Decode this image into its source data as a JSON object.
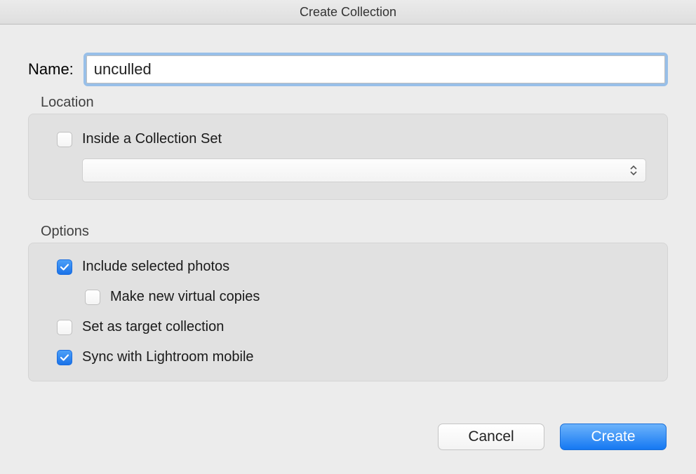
{
  "window": {
    "title": "Create Collection"
  },
  "name": {
    "label": "Name:",
    "value": "unculled"
  },
  "location": {
    "section_label": "Location",
    "inside_set": {
      "label": "Inside a Collection Set",
      "checked": false
    },
    "dropdown": {
      "value": ""
    }
  },
  "options": {
    "section_label": "Options",
    "include_selected": {
      "label": "Include selected photos",
      "checked": true
    },
    "make_virtual": {
      "label": "Make new virtual copies",
      "checked": false
    },
    "set_target": {
      "label": "Set as target collection",
      "checked": false
    },
    "sync_mobile": {
      "label": "Sync with Lightroom mobile",
      "checked": true
    }
  },
  "buttons": {
    "cancel": "Cancel",
    "create": "Create"
  }
}
